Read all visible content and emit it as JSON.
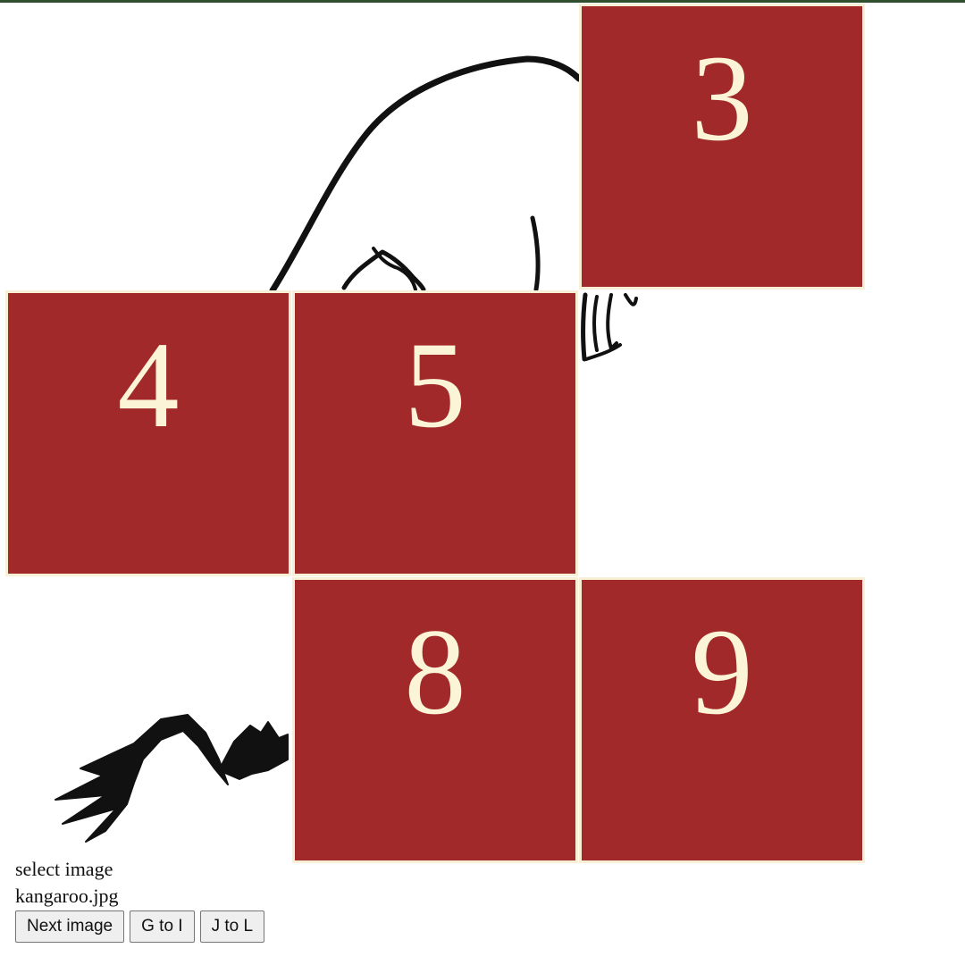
{
  "colors": {
    "top_bar": "#2f4f2f",
    "tile_fill": "#a2292a",
    "tile_number": "#fcf4d6",
    "tile_border": "#f7efd6",
    "sketch_ink": "#111111"
  },
  "tiles": [
    {
      "number": "3",
      "slot": 3
    },
    {
      "number": "4",
      "slot": 4
    },
    {
      "number": "5",
      "slot": 5
    },
    {
      "number": "8",
      "slot": 8
    },
    {
      "number": "9",
      "slot": 9
    }
  ],
  "controls": {
    "select_label": "select image",
    "filename": "kangaroo.jpg",
    "next_button": "Next image",
    "g_to_i_button": "G to I",
    "j_to_l_button": "J to L"
  }
}
